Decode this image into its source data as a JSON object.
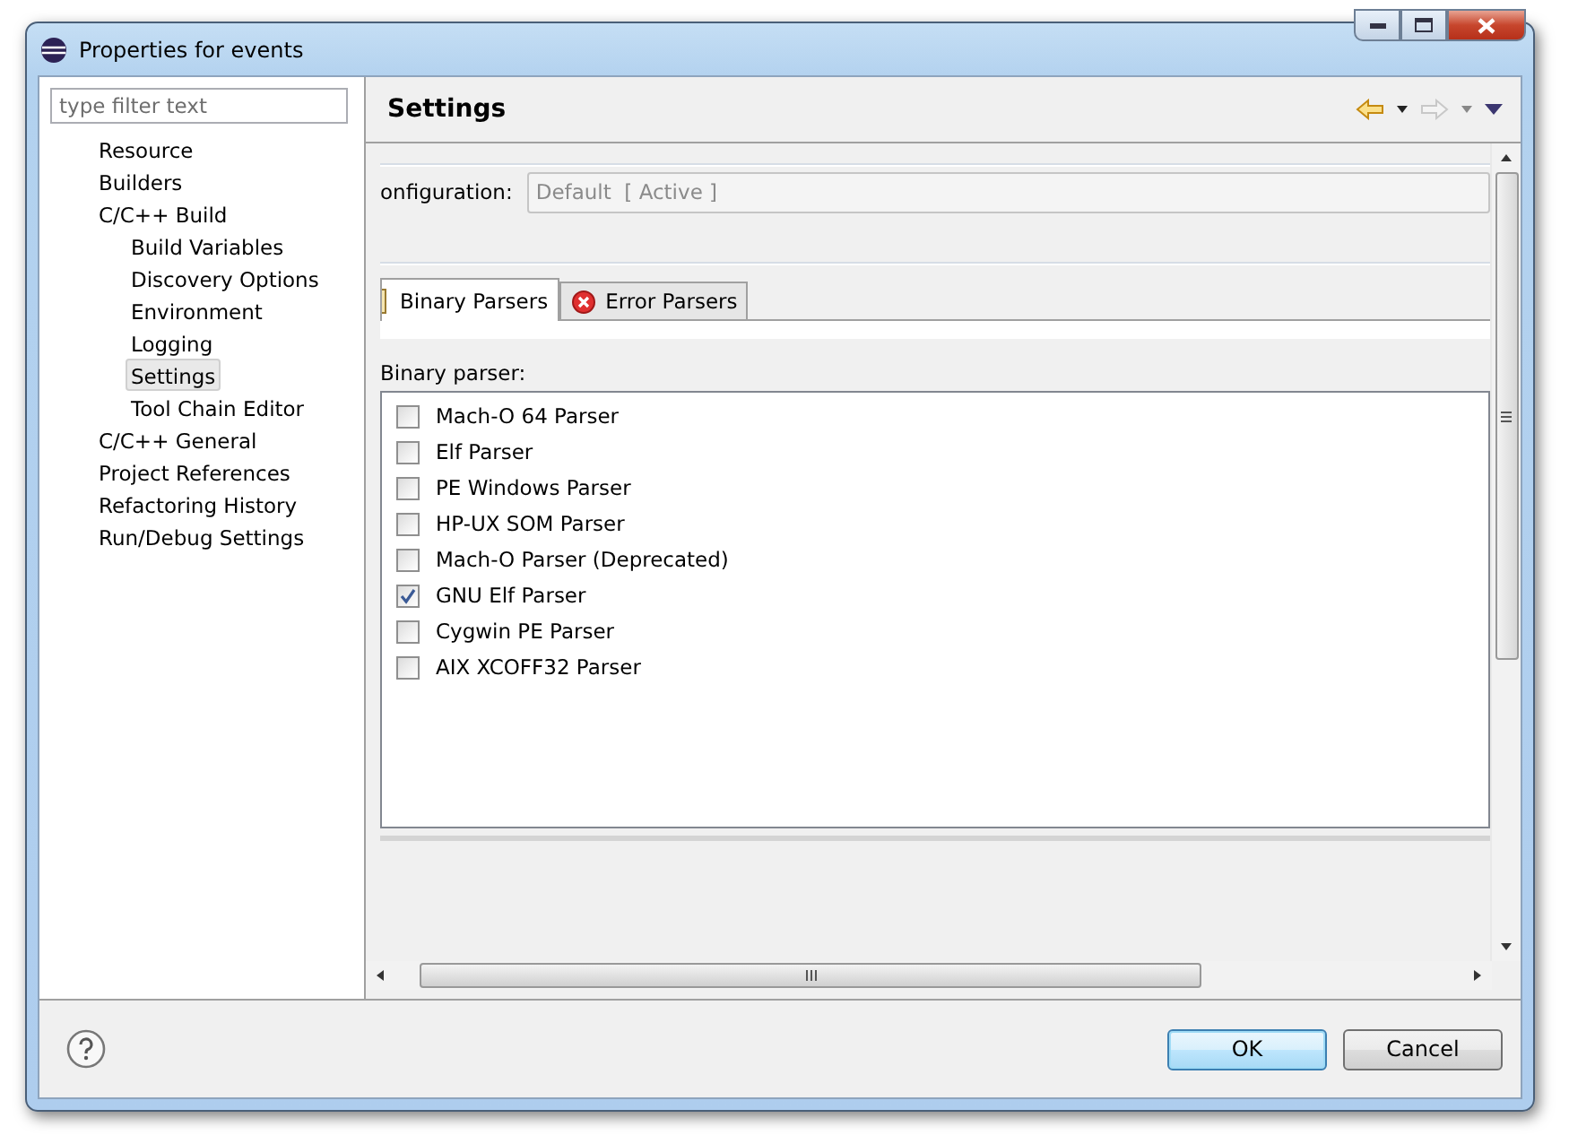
{
  "window": {
    "title": "Properties for events"
  },
  "filter": {
    "placeholder": "type filter text"
  },
  "tree": [
    {
      "label": "Resource",
      "selected": false
    },
    {
      "label": "Builders",
      "selected": false
    },
    {
      "label": "C/C++ Build",
      "selected": false,
      "children": [
        {
          "label": "Build Variables",
          "selected": false
        },
        {
          "label": "Discovery Options",
          "selected": false
        },
        {
          "label": "Environment",
          "selected": false
        },
        {
          "label": "Logging",
          "selected": false
        },
        {
          "label": "Settings",
          "selected": true
        },
        {
          "label": "Tool Chain Editor",
          "selected": false
        }
      ]
    },
    {
      "label": "C/C++ General",
      "selected": false
    },
    {
      "label": "Project References",
      "selected": false
    },
    {
      "label": "Refactoring History",
      "selected": false
    },
    {
      "label": "Run/Debug Settings",
      "selected": false
    }
  ],
  "page": {
    "title": "Settings"
  },
  "configuration": {
    "label": "onfiguration:",
    "value": "Default  [ Active ]"
  },
  "tabs": [
    {
      "label": "Binary Parsers",
      "selected": true,
      "kind": "binary"
    },
    {
      "label": "Error Parsers",
      "selected": false,
      "kind": "error"
    }
  ],
  "list_label": "Binary parser:",
  "parsers": [
    {
      "label": "Mach-O 64 Parser",
      "checked": false
    },
    {
      "label": "Elf Parser",
      "checked": false
    },
    {
      "label": "PE Windows Parser",
      "checked": false
    },
    {
      "label": "HP-UX SOM Parser",
      "checked": false
    },
    {
      "label": "Mach-O Parser (Deprecated)",
      "checked": false
    },
    {
      "label": "GNU Elf Parser",
      "checked": true
    },
    {
      "label": "Cygwin PE Parser",
      "checked": false
    },
    {
      "label": "AIX XCOFF32 Parser",
      "checked": false
    }
  ],
  "buttons": [
    {
      "label": "OK",
      "default": true
    },
    {
      "label": "Cancel",
      "default": false
    }
  ]
}
